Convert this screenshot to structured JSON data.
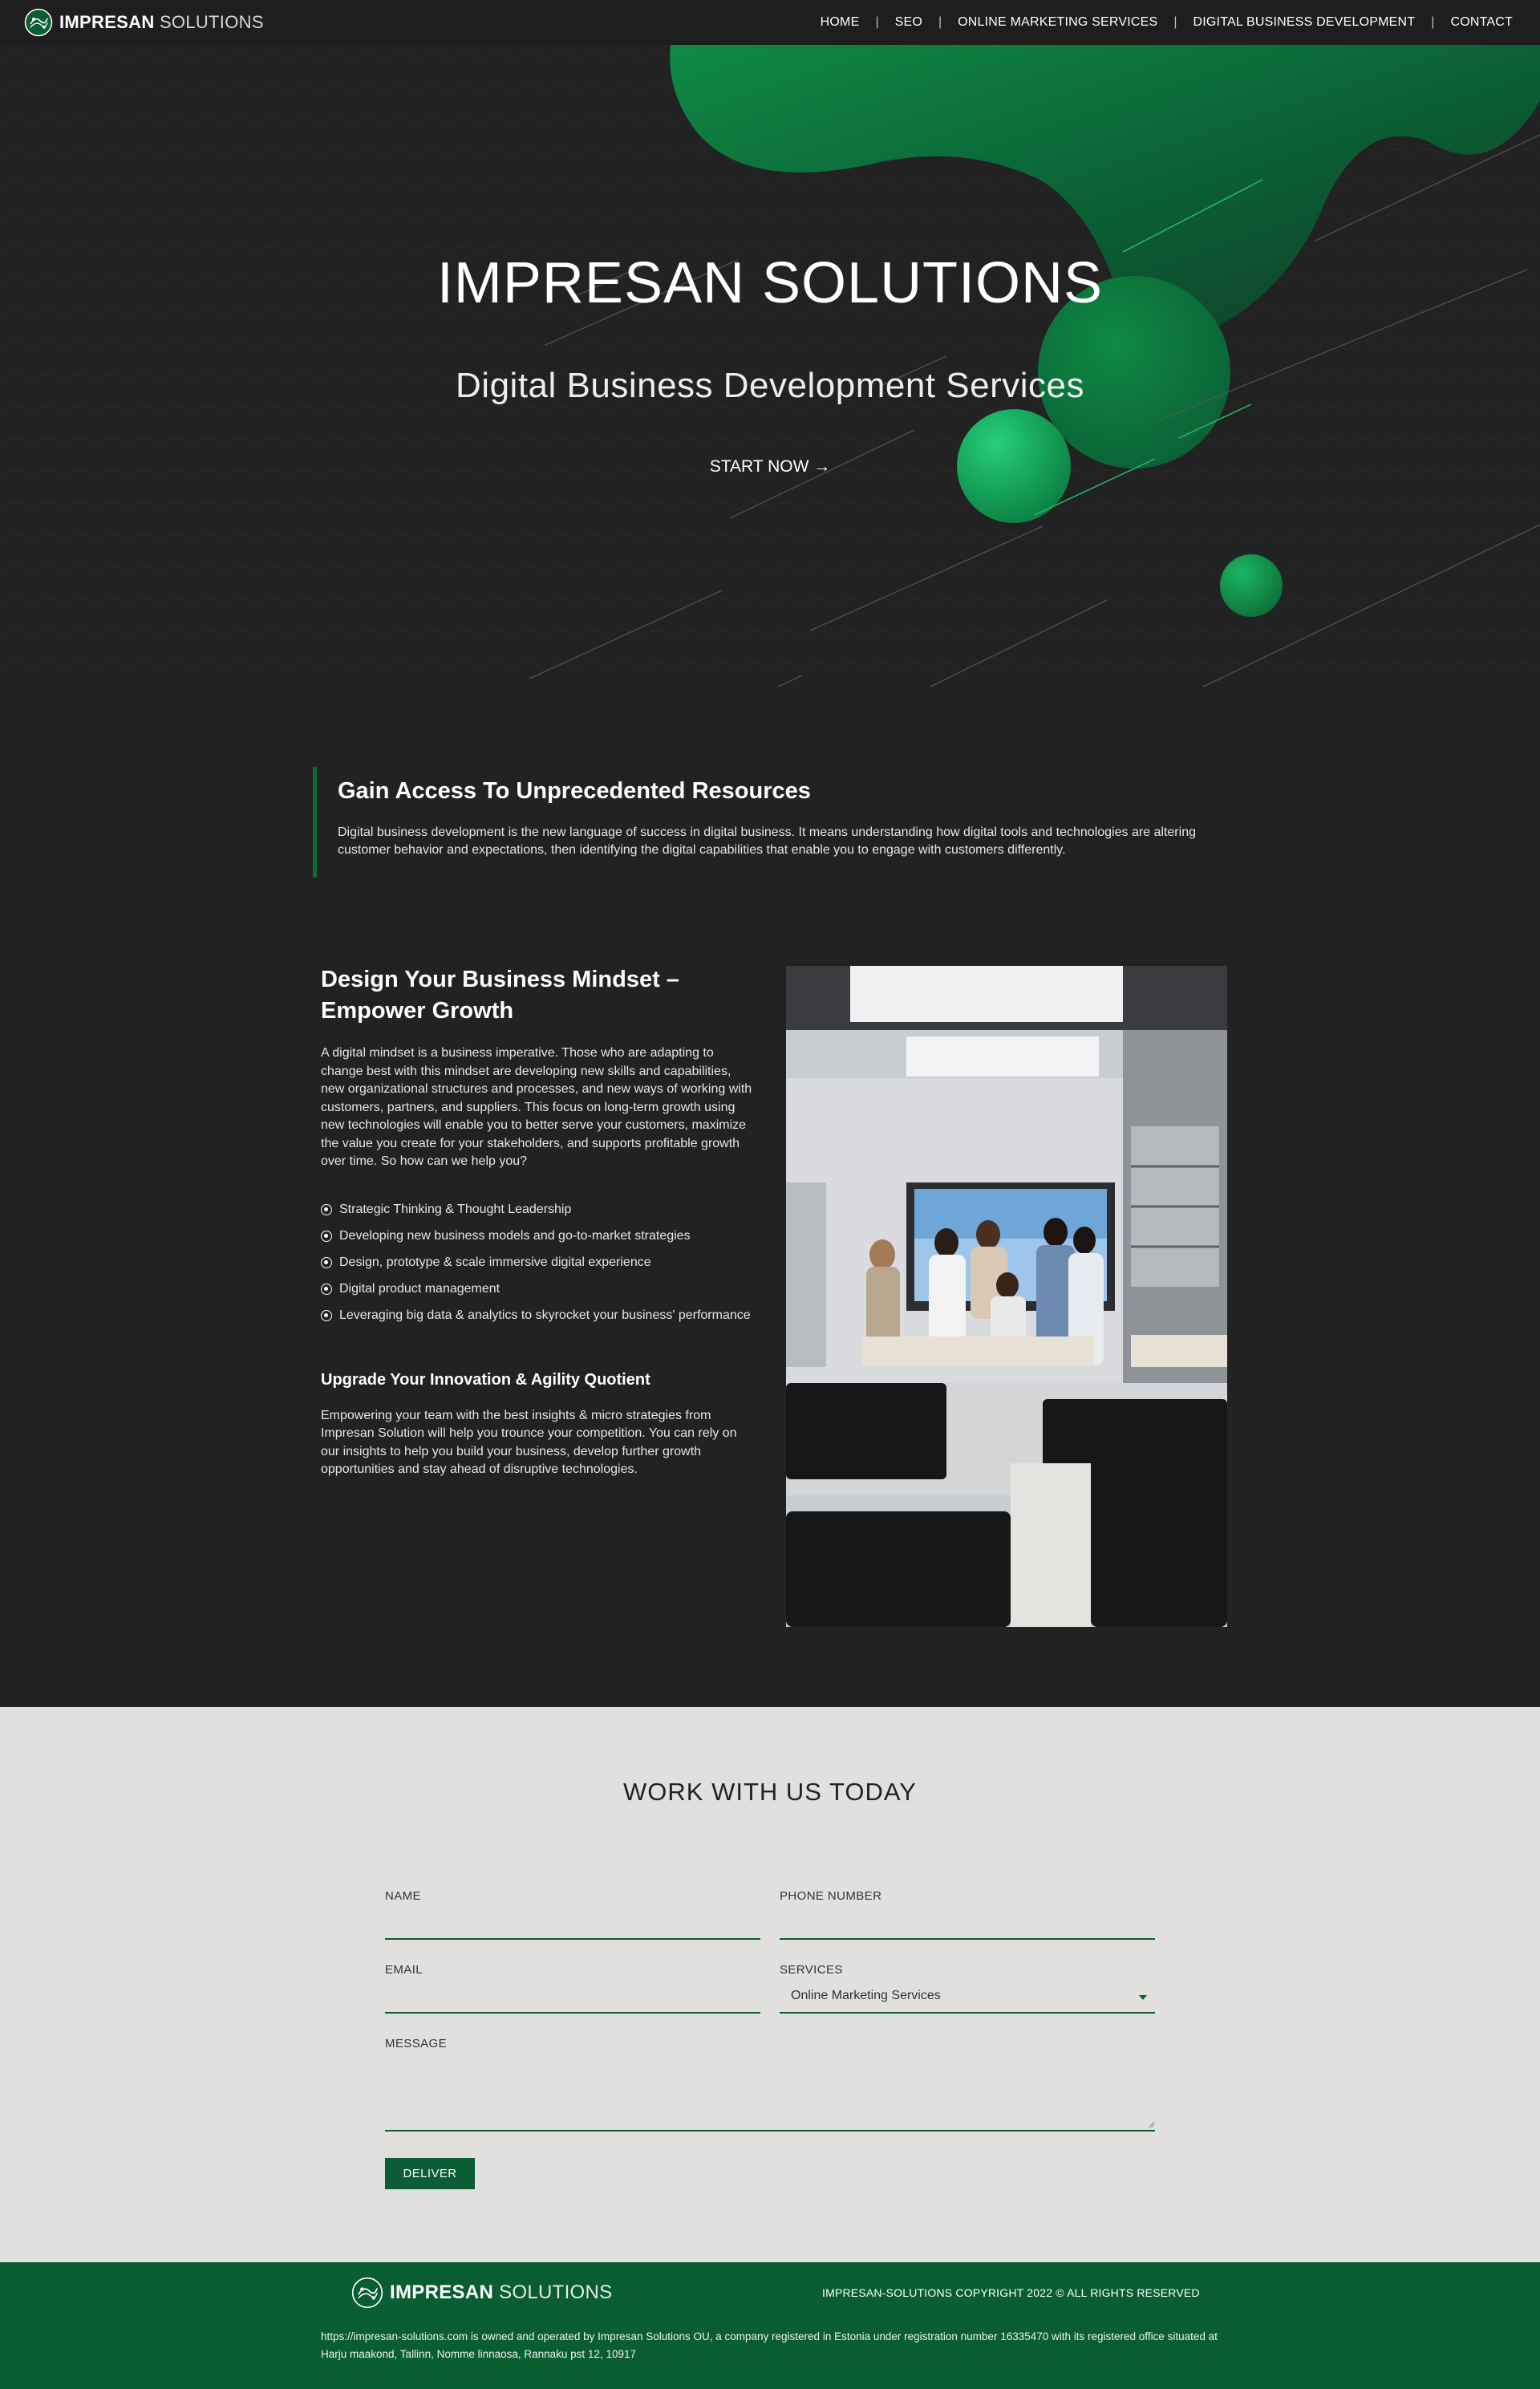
{
  "brand": {
    "name_bold": "IMPRESAN",
    "name_light": "SOLUTIONS"
  },
  "nav": {
    "items": [
      "HOME",
      "SEO",
      "ONLINE MARKETING SERVICES",
      "DIGITAL BUSINESS DEVELOPMENT",
      "CONTACT"
    ],
    "separator": "|"
  },
  "hero": {
    "title": "IMPRESAN SOLUTIONS",
    "subtitle": "Digital Business Development Services",
    "cta": "START NOW →"
  },
  "resources": {
    "title": "Gain Access To Unprecedented Resources",
    "text": "Digital business development is the new language of success in digital business. It means understanding how digital tools and technologies are altering customer behavior and expectations, then identifying the digital capabilities that enable you to engage with customers differently."
  },
  "mindset": {
    "title": "Design Your Business Mindset – Empower Growth",
    "text": "A digital mindset is a business imperative. Those who are adapting to change best with this mindset are developing new skills and capabilities, new organizational structures and processes, and new ways of working with customers, partners, and suppliers. This focus on long-term growth using new technologies will enable you to better serve your customers, maximize the value you create for your stakeholders, and supports profitable growth over time. So how can we help you?",
    "list": [
      "Strategic Thinking & Thought Leadership",
      "Developing new business models and go-to-market strategies",
      "Design, prototype & scale immersive digital experience",
      "Digital product management",
      "Leveraging big data & analytics to skyrocket your business' performance"
    ],
    "subtitle": "Upgrade Your Innovation & Agility Quotient",
    "subtext": "Empowering your team with the best insights & micro strategies from Impresan Solution will help you trounce your competition. You can rely on our insights to help you build your business, develop further growth opportunities and stay ahead of disruptive technologies."
  },
  "contact": {
    "title": "WORK WITH US TODAY",
    "name_label": "NAME",
    "phone_label": "PHONE NUMBER",
    "email_label": "EMAIL",
    "services_label": "SERVICES",
    "services_value": "Online Marketing Services",
    "message_label": "MESSAGE",
    "submit": "DELIVER"
  },
  "footer": {
    "copyright": "IMPRESAN-SOLUTIONS COPYRIGHT 2022 © ALL RIGHTS RESERVED",
    "legal": "https://impresan-solutions.com is owned and operated by Impresan Solutions OU, a company registered in Estonia under registration number 16335470 with its registered office situated at Harju maakond, Tallinn, Nomme linnaosa, Rannaku pst 12, 10917"
  },
  "colors": {
    "accent": "#0b5e33",
    "hero_green": "#13a356",
    "background_dark": "#222222",
    "contact_bg": "#e1e0df"
  }
}
